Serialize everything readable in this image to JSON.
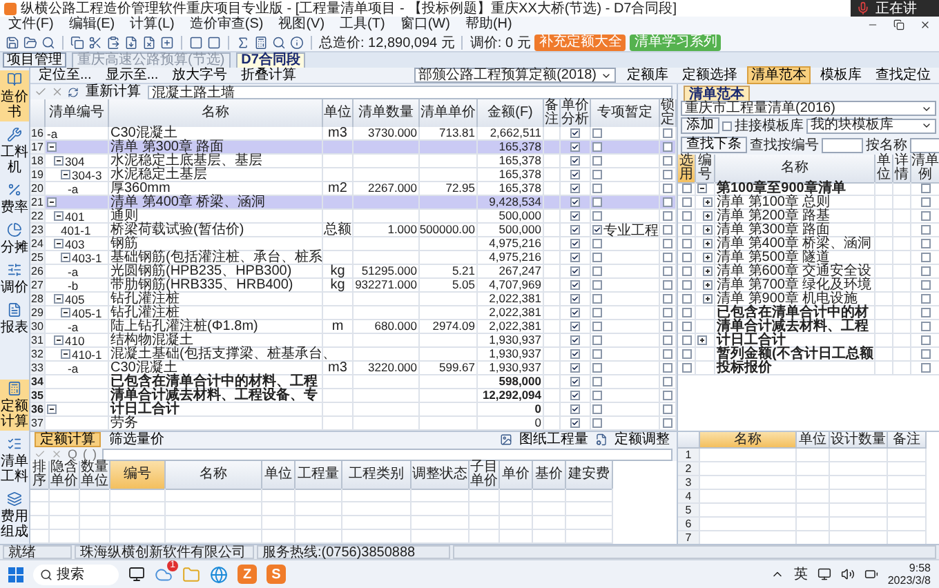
{
  "window": {
    "title": "纵横公路工程造价管理软件重庆项目专业版 - [工程量清单项目 - 【投标例题】重庆XX大桥(节选) - D7合同段]",
    "overlay": "正在讲"
  },
  "menu": [
    "文件(F)",
    "编辑(E)",
    "计算(L)",
    "造价审查(S)",
    "视图(V)",
    "工具(T)",
    "窗口(W)",
    "帮助(H)"
  ],
  "toolbar": {
    "total": "总造价: 12,890,094 元",
    "adjust": "调价: 0 元",
    "buttons": [
      {
        "label": "补充定额大全",
        "kind": "orange"
      },
      {
        "label": "清单学习系列",
        "kind": "green"
      }
    ]
  },
  "project_button": "项目管理",
  "doc_tabs": [
    {
      "label": "重庆高速公路预算(节选)",
      "selected": false
    },
    {
      "label": "D7合同段",
      "selected": true
    }
  ],
  "sidebar": {
    "top": [
      {
        "label": "造价书",
        "selected": true
      },
      {
        "label": "工料机",
        "selected": false
      },
      {
        "label": "费率",
        "selected": false
      },
      {
        "label": "分摊",
        "selected": false
      },
      {
        "label": "调价",
        "selected": false
      },
      {
        "label": "报表",
        "selected": false
      }
    ],
    "bottom": [
      {
        "label": "定额计算",
        "selected": true
      },
      {
        "label": "清单工料",
        "selected": false
      },
      {
        "label": "费用组成",
        "selected": false
      }
    ]
  },
  "view_toolbar": {
    "left": [
      "定位至...",
      "显示至...",
      "放大字号",
      "折叠计算"
    ],
    "library": "部颁公路工程预算定额(2018)",
    "right": [
      {
        "label": "定额库",
        "selected": false
      },
      {
        "label": "定额选择",
        "selected": false
      },
      {
        "label": "清单范本",
        "selected": true
      },
      {
        "label": "模板库",
        "selected": false
      },
      {
        "label": "查找定位",
        "selected": false
      }
    ]
  },
  "formula_bar": {
    "action": "重新计算",
    "value": "混凝土路土墙"
  },
  "bill_table": {
    "columns": [
      "清单编号",
      "名称",
      "单位",
      "清单数量",
      "清单单价",
      "金额(F)",
      "备注",
      "单价分析",
      "专项暂定",
      "锁定"
    ],
    "rows": [
      {
        "no": "16",
        "code": "-a",
        "name": "C30混凝土",
        "unit": "m3",
        "qty": "3730.000",
        "price": "713.81",
        "amount": "2,662,511",
        "kind": "item",
        "analysis": true,
        "special": false,
        "locked": false
      },
      {
        "no": "17",
        "name": "清单 第300章 路面",
        "amount": "165,378",
        "kind": "chapter",
        "expanded": true,
        "analysis": true,
        "special": false,
        "locked": false,
        "children": [
          {
            "no": "18",
            "code": "304",
            "name": "水泥稳定土底基层、基层",
            "amount": "165,378",
            "kind": "item",
            "expanded": true,
            "analysis": true,
            "special": false,
            "locked": false,
            "children": [
              {
                "no": "19",
                "code": "304-3",
                "name": "水泥稳定土基层",
                "amount": "165,378",
                "kind": "item",
                "expanded": true,
                "analysis": true,
                "special": false,
                "locked": false,
                "children": [
                  {
                    "no": "20",
                    "code": "-a",
                    "name": "厚360mm",
                    "unit": "m2",
                    "qty": "2267.000",
                    "price": "72.95",
                    "amount": "165,378",
                    "kind": "item",
                    "analysis": true,
                    "special": false,
                    "locked": false
                  }
                ]
              }
            ]
          }
        ]
      },
      {
        "no": "21",
        "name": "清单 第400章 桥梁、涵洞",
        "amount": "9,428,534",
        "kind": "chapter",
        "expanded": true,
        "analysis": true,
        "special": false,
        "locked": false,
        "children": [
          {
            "no": "22",
            "code": "401",
            "name": "通则",
            "amount": "500,000",
            "kind": "item",
            "expanded": true,
            "analysis": true,
            "special": false,
            "locked": false,
            "children": [
              {
                "no": "23",
                "code": "401-1",
                "name": "桥梁荷载试验(暂估价)",
                "unit": "总额",
                "qty": "1.000",
                "price": "500000.00",
                "amount": "500,000",
                "kind": "item",
                "analysis": true,
                "special": true,
                "special_text": "专业工程",
                "locked": false
              }
            ]
          },
          {
            "no": "24",
            "code": "403",
            "name": "钢筋",
            "amount": "4,975,216",
            "kind": "item",
            "expanded": true,
            "analysis": true,
            "special": false,
            "locked": false,
            "children": [
              {
                "no": "25",
                "code": "403-1",
                "name": "基础钢筋(包括灌注桩、承台、桩系",
                "amount": "4,975,216",
                "kind": "item",
                "expanded": true,
                "analysis": true,
                "special": false,
                "locked": false,
                "children": [
                  {
                    "no": "26",
                    "code": "-a",
                    "name": "光圆钢筋(HPB235、HPB300)",
                    "unit": "kg",
                    "qty": "51295.000",
                    "price": "5.21",
                    "amount": "267,247",
                    "kind": "item",
                    "analysis": true,
                    "special": false,
                    "locked": false
                  },
                  {
                    "no": "27",
                    "code": "-b",
                    "name": "带肋钢筋(HRB335、HRB400)",
                    "unit": "kg",
                    "qty": "932271.000",
                    "price": "5.05",
                    "amount": "4,707,969",
                    "kind": "item",
                    "analysis": true,
                    "special": false,
                    "locked": false
                  }
                ]
              }
            ]
          },
          {
            "no": "28",
            "code": "405",
            "name": "钻孔灌注桩",
            "amount": "2,022,381",
            "kind": "item",
            "expanded": true,
            "analysis": true,
            "special": false,
            "locked": false,
            "children": [
              {
                "no": "29",
                "code": "405-1",
                "name": "钻孔灌注桩",
                "amount": "2,022,381",
                "kind": "item",
                "expanded": true,
                "analysis": true,
                "special": false,
                "locked": false,
                "children": [
                  {
                    "no": "30",
                    "code": "-a",
                    "name": "陆上钻孔灌注桩(Φ1.8m)",
                    "unit": "m",
                    "qty": "680.000",
                    "price": "2974.09",
                    "amount": "2,022,381",
                    "kind": "item",
                    "analysis": true,
                    "special": false,
                    "locked": false
                  }
                ]
              }
            ]
          },
          {
            "no": "31",
            "code": "410",
            "name": "结构物混凝土",
            "amount": "1,930,937",
            "kind": "item",
            "expanded": true,
            "analysis": true,
            "special": false,
            "locked": false,
            "children": [
              {
                "no": "32",
                "code": "410-1",
                "name": "混凝土基础(包括支撑梁、桩基承台、",
                "amount": "1,930,937",
                "kind": "item",
                "expanded": true,
                "analysis": true,
                "special": false,
                "locked": false,
                "children": [
                  {
                    "no": "33",
                    "code": "-a",
                    "name": "C30混凝土",
                    "unit": "m3",
                    "qty": "3220.000",
                    "price": "599.67",
                    "amount": "1,930,937",
                    "kind": "item",
                    "analysis": true,
                    "special": false,
                    "locked": false
                  }
                ]
              }
            ]
          }
        ]
      },
      {
        "no": "34",
        "name": "已包含在清单合计中的材料、工程",
        "amount": "598,000",
        "kind": "total",
        "analysis": true,
        "special": false,
        "locked": false
      },
      {
        "no": "35",
        "name": "清单合计减去材料、工程设备、专",
        "amount": "12,292,094",
        "kind": "total",
        "analysis": true,
        "special": false,
        "locked": false
      },
      {
        "no": "36",
        "name": "计日工合计",
        "amount": "0",
        "kind": "total",
        "expanded": true,
        "analysis": true,
        "special": false,
        "locked": false,
        "children": [
          {
            "no": "37",
            "name": "劳务",
            "amount": "0",
            "kind": "item",
            "analysis": true,
            "special": false,
            "locked": false
          }
        ]
      }
    ]
  },
  "template_panel": {
    "tab": "清单范本",
    "source": "重庆市工程量清单(2016)",
    "add": "添加",
    "attach": {
      "label": "挂接模板库",
      "checked": false
    },
    "template_lib": "我的块模板库",
    "find_next": "查找下条",
    "find_code_label": "查找按编号",
    "find_name_label": "按名称",
    "columns": [
      "选用",
      "编号",
      "名称",
      "单位",
      "详情",
      "清单例"
    ],
    "rows": [
      {
        "name": "第100章至900章清单",
        "kind": "total",
        "expanded": true,
        "checked": false,
        "sample": false,
        "children": [
          {
            "name": "清单 第100章 总则",
            "kind": "item",
            "expanded": false,
            "checked": false,
            "sample": false
          },
          {
            "name": "清单 第200章 路基",
            "kind": "item",
            "expanded": false,
            "checked": false,
            "sample": false
          },
          {
            "name": "清单 第300章 路面",
            "kind": "item",
            "expanded": false,
            "checked": false,
            "sample": false
          },
          {
            "name": "清单 第400章 桥梁、涵洞",
            "kind": "item",
            "expanded": false,
            "checked": false,
            "sample": false
          },
          {
            "name": "清单 第500章 隧道",
            "kind": "item",
            "expanded": false,
            "checked": false,
            "sample": false
          },
          {
            "name": "清单 第600章 交通安全设",
            "kind": "item",
            "expanded": false,
            "checked": false,
            "sample": false
          },
          {
            "name": "清单 第700章 绿化及环境",
            "kind": "item",
            "expanded": false,
            "checked": false,
            "sample": false
          },
          {
            "name": "清单 第900章 机电设施",
            "kind": "item",
            "expanded": false,
            "checked": false,
            "sample": false
          }
        ]
      },
      {
        "name": "已包含在清单合计中的材",
        "kind": "total",
        "checked": false,
        "sample": false
      },
      {
        "name": "清单合计减去材料、工程",
        "kind": "total",
        "checked": false,
        "sample": false
      },
      {
        "name": "计日工合计",
        "kind": "total",
        "expanded": false,
        "checked": false,
        "sample": false
      },
      {
        "name": "暂列金额(不含计日工总额",
        "kind": "total",
        "checked": false,
        "sample": false
      },
      {
        "name": "投标报价",
        "kind": "total",
        "checked": false,
        "sample": false
      }
    ]
  },
  "quota_panel": {
    "tabs": [
      {
        "label": "定额计算",
        "selected": true
      },
      {
        "label": "筛选量价",
        "selected": false
      }
    ],
    "tools": [
      "图纸工程量",
      "定额调整"
    ],
    "symbols": [
      "Q",
      "(",
      ")"
    ],
    "columns": [
      {
        "label": "排序",
        "selected": false
      },
      {
        "label": "隐含单价",
        "selected": false
      },
      {
        "label": "数量单位",
        "selected": false
      },
      {
        "label": "编号",
        "selected": true
      },
      {
        "label": "名称",
        "selected": false
      },
      {
        "label": "单位",
        "selected": false
      },
      {
        "label": "工程量",
        "selected": false
      },
      {
        "label": "工程类别",
        "selected": false
      },
      {
        "label": "调整状态",
        "selected": false
      },
      {
        "label": "子目单价",
        "selected": false
      },
      {
        "label": "单价",
        "selected": false
      },
      {
        "label": "基价",
        "selected": false
      },
      {
        "label": "建安费",
        "selected": false
      }
    ]
  },
  "material_table": {
    "columns": [
      {
        "label": "名称",
        "selected": true
      },
      {
        "label": "单位",
        "selected": false
      },
      {
        "label": "设计数量",
        "selected": false
      },
      {
        "label": "备注",
        "selected": false
      }
    ],
    "row_numbers": [
      "1",
      "2",
      "3",
      "4",
      "5",
      "6",
      "7"
    ]
  },
  "status_bar": [
    "就绪",
    "珠海纵横创新软件有限公司",
    "服务热线:(0756)3850888"
  ],
  "taskbar": {
    "search": "搜索",
    "badge": "1",
    "apps": [
      "Z",
      "S"
    ],
    "ime": "英",
    "time": "9:58",
    "date": "2023/3/8"
  }
}
